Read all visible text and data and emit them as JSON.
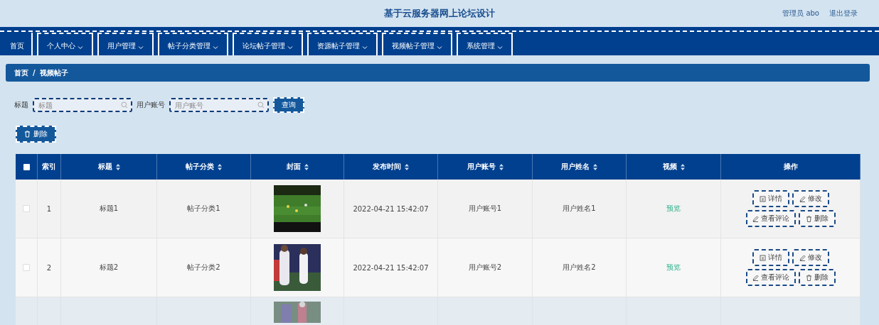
{
  "header": {
    "title": "基于云服务器网上论坛设计",
    "user": "管理员 abo",
    "logout": "退出登录"
  },
  "nav": [
    {
      "label": "首页",
      "dropdown": false
    },
    {
      "label": "个人中心",
      "dropdown": true
    },
    {
      "label": "用户管理",
      "dropdown": true
    },
    {
      "label": "帖子分类管理",
      "dropdown": true
    },
    {
      "label": "论坛帖子管理",
      "dropdown": true
    },
    {
      "label": "资源帖子管理",
      "dropdown": true
    },
    {
      "label": "视频帖子管理",
      "dropdown": true
    },
    {
      "label": "系统管理",
      "dropdown": true
    }
  ],
  "breadcrumb": [
    "首页",
    "视频帖子"
  ],
  "breadcrumb_separator": "/",
  "search": {
    "fields": [
      {
        "label": "标题",
        "placeholder": "标题"
      },
      {
        "label": "用户账号",
        "placeholder": "用户账号"
      }
    ],
    "button": "查询"
  },
  "delete_button": "删除",
  "table": {
    "select_all": {
      "checked": false
    },
    "columns": [
      {
        "label": "索引",
        "sortable": false
      },
      {
        "label": "标题",
        "sortable": true
      },
      {
        "label": "帖子分类",
        "sortable": true
      },
      {
        "label": "封面",
        "sortable": true
      },
      {
        "label": "发布时间",
        "sortable": true
      },
      {
        "label": "用户账号",
        "sortable": true
      },
      {
        "label": "用户姓名",
        "sortable": true
      },
      {
        "label": "视频",
        "sortable": true
      },
      {
        "label": "操作",
        "sortable": false
      }
    ],
    "rows": [
      {
        "checked": false,
        "index": "1",
        "title": "标题1",
        "category": "帖子分类1",
        "time": "2022-04-21 15:42:07",
        "account": "用户账号1",
        "name": "用户姓名1",
        "video": "预览",
        "actions": [
          "详情",
          "修改",
          "查看评论",
          "删除"
        ]
      },
      {
        "checked": false,
        "index": "2",
        "title": "标题2",
        "category": "帖子分类2",
        "time": "2022-04-21 15:42:07",
        "account": "用户账号2",
        "name": "用户姓名2",
        "video": "预览",
        "actions": [
          "详情",
          "修改",
          "查看评论",
          "删除"
        ]
      }
    ]
  }
}
